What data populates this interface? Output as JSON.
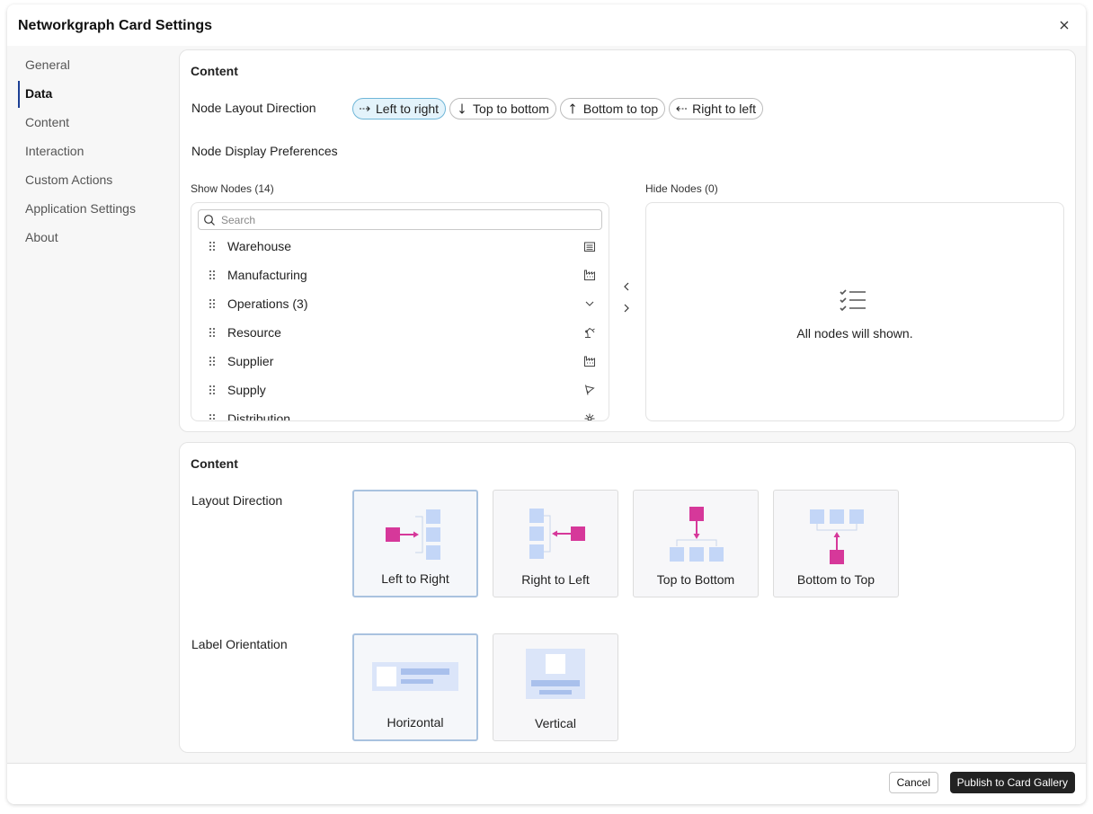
{
  "dialog": {
    "title": "Networkgraph Card Settings"
  },
  "sidebar": {
    "items": [
      {
        "label": "General",
        "active": false
      },
      {
        "label": "Data",
        "active": true
      },
      {
        "label": "Content",
        "active": false
      },
      {
        "label": "Interaction",
        "active": false
      },
      {
        "label": "Custom Actions",
        "active": false
      },
      {
        "label": "Application Settings",
        "active": false
      },
      {
        "label": "About",
        "active": false
      }
    ]
  },
  "content_panel": {
    "heading": "Content",
    "node_layout_direction": {
      "label": "Node Layout Direction",
      "selected": "Left to right",
      "options": [
        {
          "label": "Left to right",
          "icon": "arrow-right-dashed-icon"
        },
        {
          "label": "Top to bottom",
          "icon": "arrow-down-icon"
        },
        {
          "label": "Bottom to top",
          "icon": "arrow-up-icon"
        },
        {
          "label": "Right to left",
          "icon": "arrow-left-dashed-icon"
        }
      ]
    },
    "node_display_preferences": {
      "label": "Node Display Preferences",
      "show_nodes": {
        "label": "Show Nodes (14)",
        "search_placeholder": "Search",
        "items": [
          {
            "label": "Warehouse",
            "icon": "warehouse-icon"
          },
          {
            "label": "Manufacturing",
            "icon": "factory-icon"
          },
          {
            "label": "Operations (3)",
            "icon": "chevron-down-icon"
          },
          {
            "label": "Resource",
            "icon": "robot-arm-icon"
          },
          {
            "label": "Supplier",
            "icon": "factory-icon"
          },
          {
            "label": "Supply",
            "icon": "flag-icon"
          },
          {
            "label": "Distribution",
            "icon": "hub-icon"
          }
        ]
      },
      "hide_nodes": {
        "label": "Hide Nodes (0)",
        "empty_message": "All nodes will shown."
      }
    }
  },
  "layout_panel": {
    "heading": "Content",
    "layout_direction": {
      "label": "Layout Direction",
      "selected": "Left to Right",
      "options": [
        "Left to Right",
        "Right to Left",
        "Top to Bottom",
        "Bottom to Top"
      ]
    },
    "label_orientation": {
      "label": "Label Orientation",
      "selected": "Horizontal",
      "options": [
        "Horizontal",
        "Vertical"
      ]
    }
  },
  "footer": {
    "cancel_label": "Cancel",
    "publish_label": "Publish to Card Gallery"
  },
  "colors": {
    "accent_pink": "#d6389a",
    "diagram_blue": "#c3d6f7",
    "active_nav_bar": "#1c3f94",
    "pill_active_bg": "#e3f3fb"
  }
}
